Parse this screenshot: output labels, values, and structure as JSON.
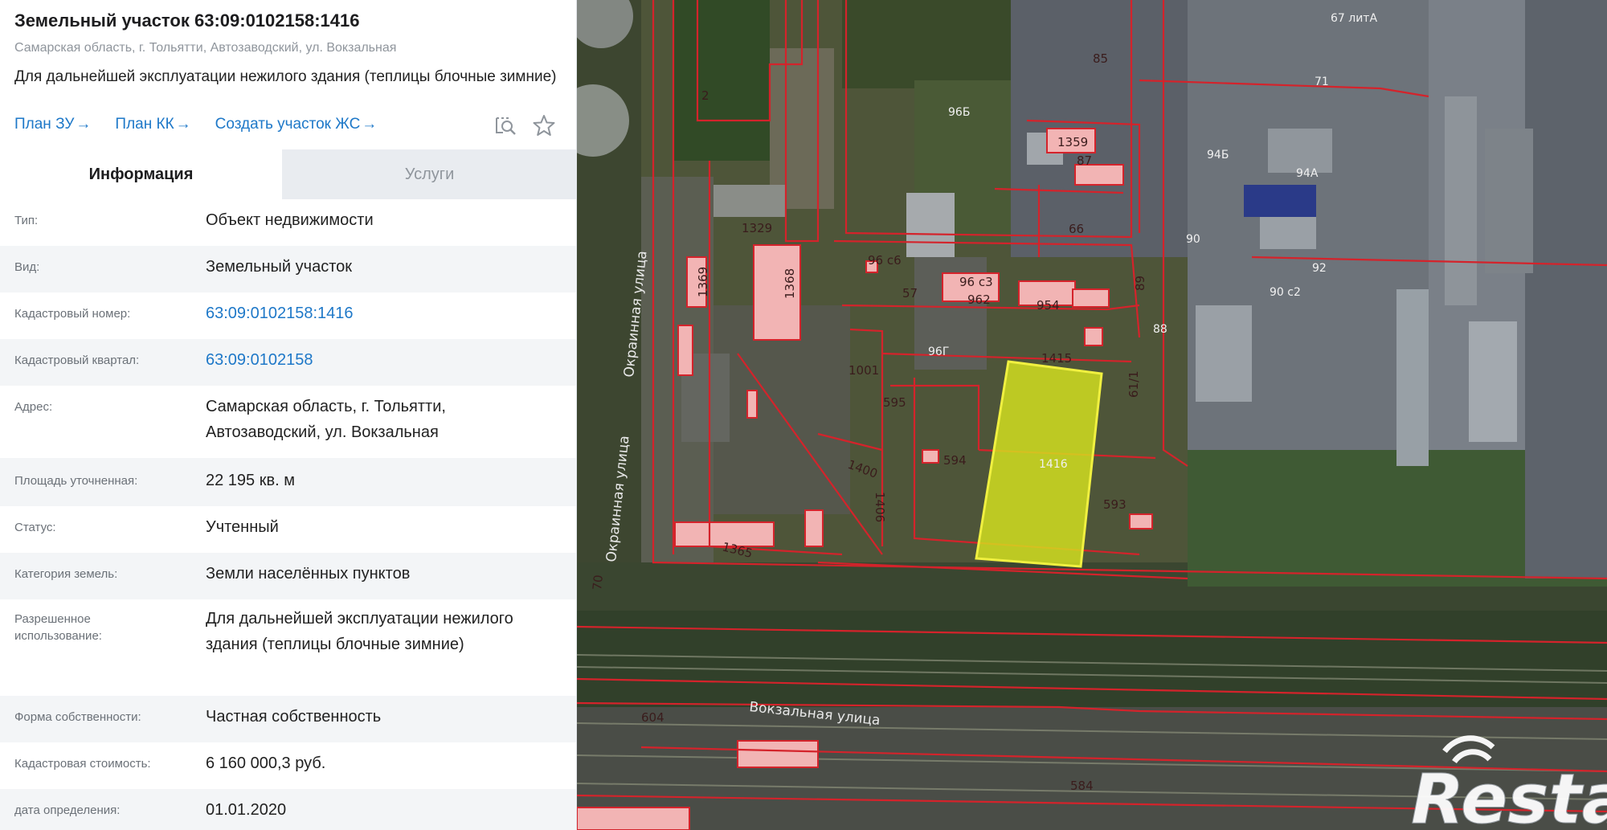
{
  "header": {
    "title": "Земельный участок 63:09:0102158:1416",
    "address": "Самарская область, г. Тольятти, Автозаводский, ул. Вокзальная",
    "purpose": "Для дальнейшей эксплуатации нежилого здания (теплицы блочные зимние)",
    "links": [
      {
        "label": "План ЗУ",
        "arrow": "→"
      },
      {
        "label": "План КК",
        "arrow": "→"
      },
      {
        "label": "Создать участок ЖС",
        "arrow": "→"
      }
    ],
    "tools": [
      "search-on-map-icon",
      "star-icon"
    ]
  },
  "tabs": [
    {
      "label": "Информация",
      "active": true
    },
    {
      "label": "Услуги",
      "active": false
    }
  ],
  "info": [
    {
      "label": "Тип:",
      "value": "Объект недвижимости"
    },
    {
      "label": "Вид:",
      "value": "Земельный участок"
    },
    {
      "label": "Кадастровый номер:",
      "value": "63:09:0102158:1416",
      "link": true
    },
    {
      "label": "Кадастровый квартал:",
      "value": "63:09:0102158",
      "link": true
    },
    {
      "label": "Адрес:",
      "value": "Самарская область, г. Тольятти, Автозаводский, ул. Вокзальная"
    },
    {
      "label": "Площадь уточненная:",
      "value": "22 195 кв. м"
    },
    {
      "label": "Статус:",
      "value": "Учтенный"
    },
    {
      "label": "Категория земель:",
      "value": "Земли населённых пунктов"
    },
    {
      "label": "Разрешенное использование:",
      "value": "Для дальнейшей эксплуатации нежилого здания (теплицы блочные зимние)"
    },
    {
      "label": "Форма собственности:",
      "value": "Частная собственность"
    },
    {
      "label": "Кадастровая стоимость:",
      "value": "6 160 000,3 руб."
    },
    {
      "label": "дата определения:",
      "value": "01.01.2020"
    }
  ],
  "map": {
    "streets": {
      "okrainnaya": "Окраинная улица",
      "vokzalnaya": "Вокзальная улица"
    },
    "selected_parcel": "1416",
    "parcel_labels": [
      "2",
      "85",
      "96Б",
      "1359",
      "87",
      "94Б",
      "94А",
      "67 литА",
      "71",
      "1329",
      "1369",
      "1368",
      "96 с6",
      "57",
      "96 с3",
      "962",
      "954",
      "66",
      "89",
      "90",
      "92",
      "90 с2",
      "88",
      "96Г",
      "1415",
      "61/1",
      "1001",
      "595",
      "594",
      "593",
      "1400",
      "1406",
      "1365",
      "70",
      "604",
      "584"
    ],
    "watermark": "Restate",
    "colors": {
      "parcel_border": "#d4232b",
      "selected_fill": "#d6e31e",
      "building_fill": "#f2b4b4"
    }
  }
}
